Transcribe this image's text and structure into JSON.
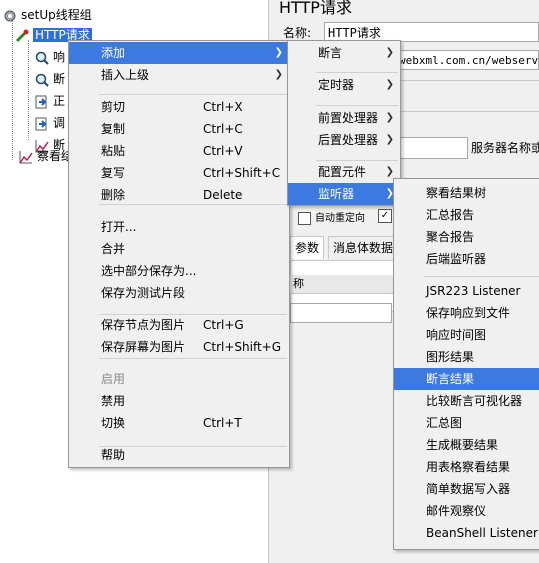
{
  "tree": {
    "thread_group": "setUp线程组",
    "selected": "HTTP请求",
    "partial_items": [
      "响",
      "断",
      "正",
      "调",
      "断"
    ],
    "listener_partial": "察看结"
  },
  "panel": {
    "title": "HTTP请求",
    "name_label": "名称:",
    "name_value": "HTTP请求",
    "url_partial": "webxml.com.cn/webserv",
    "server_label": "服务器名称或",
    "redirect_label": "自动重定向",
    "tab_params": "参数",
    "tab_body": "消息体数据",
    "param_header": "称"
  },
  "menu_main": {
    "items": [
      {
        "label": "添加",
        "accel": "",
        "submenu": true,
        "state": "highlight"
      },
      {
        "label": "插入上级",
        "accel": "",
        "submenu": true,
        "state": "normal"
      },
      {
        "label": "剪切",
        "accel": "Ctrl+X",
        "submenu": false,
        "state": "normal"
      },
      {
        "label": "复制",
        "accel": "Ctrl+C",
        "submenu": false,
        "state": "normal"
      },
      {
        "label": "粘贴",
        "accel": "Ctrl+V",
        "submenu": false,
        "state": "normal"
      },
      {
        "label": "复写",
        "accel": "Ctrl+Shift+C",
        "submenu": false,
        "state": "normal"
      },
      {
        "label": "删除",
        "accel": "Delete",
        "submenu": false,
        "state": "normal"
      },
      {
        "label": "打开...",
        "accel": "",
        "submenu": false,
        "state": "normal"
      },
      {
        "label": "合并",
        "accel": "",
        "submenu": false,
        "state": "normal"
      },
      {
        "label": "选中部分保存为...",
        "accel": "",
        "submenu": false,
        "state": "normal"
      },
      {
        "label": "保存为测试片段",
        "accel": "",
        "submenu": false,
        "state": "normal"
      },
      {
        "label": "保存节点为图片",
        "accel": "Ctrl+G",
        "submenu": false,
        "state": "normal"
      },
      {
        "label": "保存屏幕为图片",
        "accel": "Ctrl+Shift+G",
        "submenu": false,
        "state": "normal"
      },
      {
        "label": "启用",
        "accel": "",
        "submenu": false,
        "state": "disabled"
      },
      {
        "label": "禁用",
        "accel": "",
        "submenu": false,
        "state": "normal"
      },
      {
        "label": "切换",
        "accel": "Ctrl+T",
        "submenu": false,
        "state": "normal"
      },
      {
        "label": "帮助",
        "accel": "",
        "submenu": false,
        "state": "normal"
      }
    ]
  },
  "menu_add": {
    "items": [
      {
        "label": "断言",
        "state": "normal"
      },
      {
        "label": "定时器",
        "state": "normal"
      },
      {
        "label": "前置处理器",
        "state": "normal"
      },
      {
        "label": "后置处理器",
        "state": "normal"
      },
      {
        "label": "配置元件",
        "state": "normal"
      },
      {
        "label": "监听器",
        "state": "highlight"
      }
    ]
  },
  "menu_listener": {
    "items": [
      {
        "label": "察看结果树",
        "state": "normal"
      },
      {
        "label": "汇总报告",
        "state": "normal"
      },
      {
        "label": "聚合报告",
        "state": "normal"
      },
      {
        "label": "后端监听器",
        "state": "normal"
      },
      {
        "label": "JSR223 Listener",
        "state": "normal"
      },
      {
        "label": "保存响应到文件",
        "state": "normal"
      },
      {
        "label": "响应时间图",
        "state": "normal"
      },
      {
        "label": "图形结果",
        "state": "normal"
      },
      {
        "label": "断言结果",
        "state": "highlight"
      },
      {
        "label": "比较断言可视化器",
        "state": "normal"
      },
      {
        "label": "汇总图",
        "state": "normal"
      },
      {
        "label": "生成概要结果",
        "state": "normal"
      },
      {
        "label": "用表格察看结果",
        "state": "normal"
      },
      {
        "label": "简单数据写入器",
        "state": "normal"
      },
      {
        "label": "邮件观察仪",
        "state": "normal"
      },
      {
        "label": "BeanShell Listener",
        "state": "normal"
      }
    ]
  },
  "colors": {
    "highlight": "#3d7ae0",
    "menu_bg": "#f0f0f0",
    "selected_node": "#2f6fd6"
  }
}
